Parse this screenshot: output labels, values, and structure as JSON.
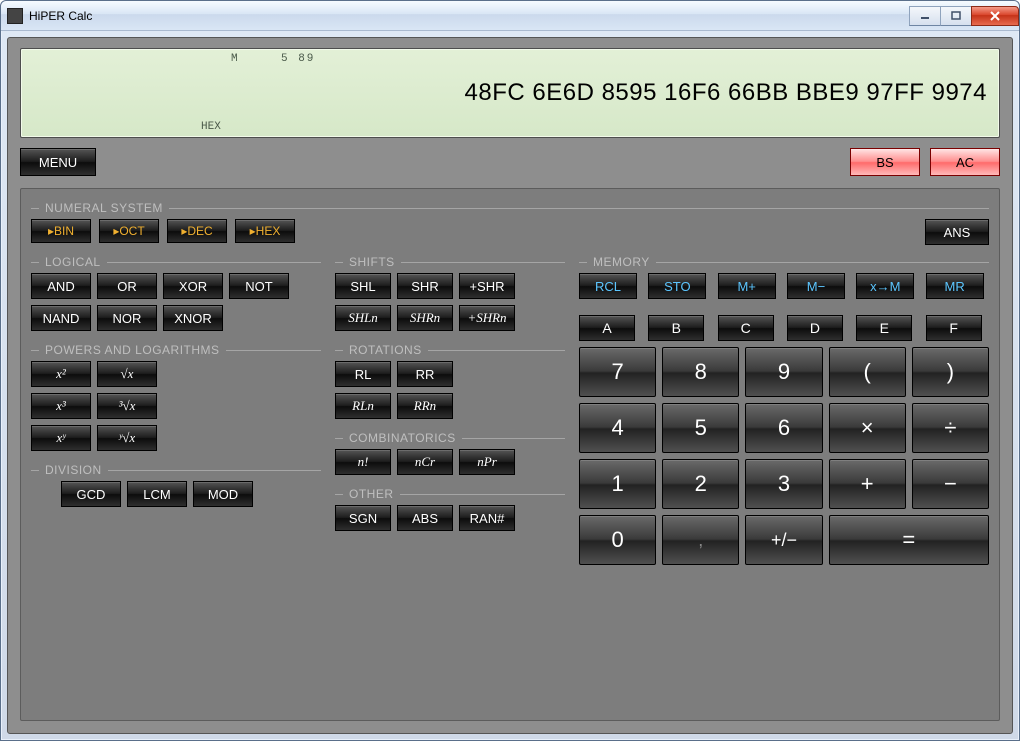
{
  "window": {
    "title": "HiPER Calc"
  },
  "display": {
    "indicators": {
      "m": "M",
      "digits": "5   89",
      "mode": "HEX"
    },
    "value": "48FC 6E6D 8595 16F6 66BB BBE9 97FF 9974"
  },
  "top": {
    "menu": "MENU",
    "bs": "BS",
    "ac": "AC"
  },
  "numeral": {
    "label": "NUMERAL SYSTEM",
    "bin": "▸BIN",
    "oct": "▸OCT",
    "dec": "▸DEC",
    "hex": "▸HEX",
    "ans": "ANS"
  },
  "logical": {
    "label": "LOGICAL",
    "and": "AND",
    "or": "OR",
    "xor": "XOR",
    "not": "NOT",
    "nand": "NAND",
    "nor": "NOR",
    "xnor": "XNOR"
  },
  "powers": {
    "label": "POWERS AND LOGARITHMS",
    "x2": "x²",
    "sqrt": "√x",
    "x3": "x³",
    "cbrt": "³√x",
    "xy": "xʸ",
    "yroot": "ʸ√x"
  },
  "division": {
    "label": "DIVISION",
    "gcd": "GCD",
    "lcm": "LCM",
    "mod": "MOD"
  },
  "shifts": {
    "label": "SHIFTS",
    "shl": "SHL",
    "shr": "SHR",
    "pshr": "+SHR",
    "shln": "SHLn",
    "shrn": "SHRn",
    "pshrn": "+SHRn"
  },
  "rotations": {
    "label": "ROTATIONS",
    "rl": "RL",
    "rr": "RR",
    "rln": "RLn",
    "rrn": "RRn"
  },
  "comb": {
    "label": "COMBINATORICS",
    "fact": "n!",
    "ncr": "nCr",
    "npr": "nPr"
  },
  "other": {
    "label": "OTHER",
    "sgn": "SGN",
    "abs": "ABS",
    "ran": "RAN#"
  },
  "memory": {
    "label": "MEMORY",
    "rcl": "RCL",
    "sto": "STO",
    "mplus": "M+",
    "mminus": "M−",
    "xtoM": "x→M",
    "mr": "MR"
  },
  "hex": {
    "a": "A",
    "b": "B",
    "c": "C",
    "d": "D",
    "e": "E",
    "f": "F"
  },
  "keys": {
    "k7": "7",
    "k8": "8",
    "k9": "9",
    "lpar": "(",
    "rpar": ")",
    "k4": "4",
    "k5": "5",
    "k6": "6",
    "mul": "×",
    "div": "÷",
    "k1": "1",
    "k2": "2",
    "k3": "3",
    "add": "+",
    "sub": "−",
    "k0": "0",
    "comma": ",",
    "pm": "+/−",
    "eq": "="
  }
}
